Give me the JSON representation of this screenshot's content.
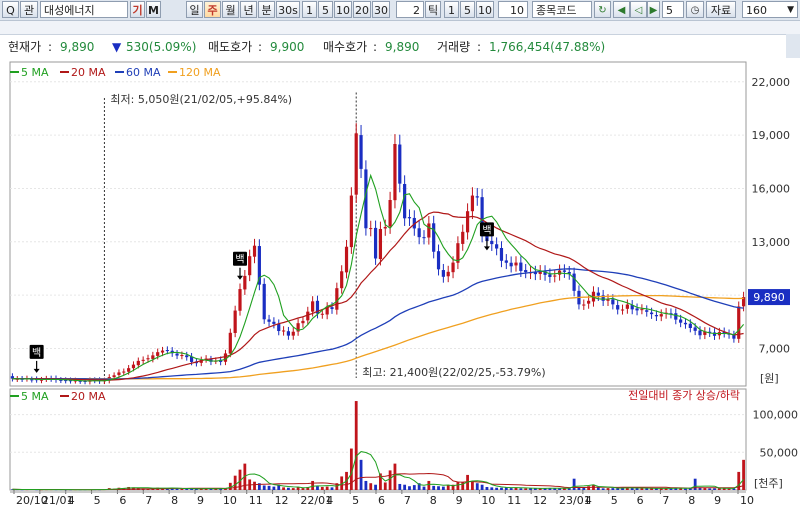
{
  "toolbar": {
    "search_label": "Q",
    "search_tag": "관",
    "stock_name": "대성에너지",
    "gi_button": "기",
    "m_button": "M",
    "periods": [
      "일",
      "주",
      "월",
      "년",
      "분",
      "30s",
      "1",
      "5",
      "10",
      "20",
      "30"
    ],
    "active_period": "주",
    "tick_value": "2",
    "tick_label": "틱",
    "tick_options": [
      "1",
      "5",
      "10"
    ],
    "interval_value": "10",
    "code_field": "종목코드",
    "step_value": "5",
    "data_label": "자료",
    "count_value": "160"
  },
  "info": {
    "price_label": "현재가",
    "price_value": "9,890",
    "change_value": "530(5.09%)",
    "ask_label": "매도호가",
    "ask_value": "9,900",
    "bid_label": "매수호가",
    "bid_value": "9,890",
    "volume_label": "거래량",
    "volume_value": "1,766,454(47.88%)"
  },
  "colors": {
    "up": "#c0141b",
    "down": "#1a2ec2",
    "ma5": "#20a020",
    "ma20": "#b01818",
    "ma60": "#1f3fb8",
    "ma120": "#f0a020"
  },
  "chart_data": [
    {
      "type": "candlestick",
      "legend": [
        "5 MA",
        "20 MA",
        "60 MA",
        "120 MA"
      ],
      "y_ticks": [
        7000,
        10000,
        13000,
        16000,
        19000,
        22000
      ],
      "ylim": [
        5000,
        23000
      ],
      "unit_label": "[원]",
      "x_ticks": [
        "20/10",
        "21/01",
        "4",
        "5",
        "6",
        "7",
        "8",
        "9",
        "10",
        "11",
        "12",
        "22/01",
        "4",
        "5",
        "6",
        "7",
        "8",
        "9",
        "10",
        "11",
        "12",
        "23/01",
        "4",
        "5",
        "6",
        "7",
        "8",
        "9",
        "10"
      ],
      "current_price_label": "9,890",
      "annotations": {
        "low": "최저: 5,050원(21/02/05,+95.84%)",
        "high": "최고: 21,400원(22/02/25,-53.79%)",
        "signal": "백"
      },
      "close": [
        5300,
        5290,
        5270,
        5310,
        5240,
        5230,
        5240,
        5300,
        5280,
        5230,
        5210,
        5190,
        5180,
        5200,
        5160,
        5140,
        5210,
        5200,
        5160,
        5200,
        5390,
        5490,
        5650,
        5700,
        5890,
        6090,
        6300,
        6360,
        6450,
        6610,
        6790,
        6880,
        6880,
        6730,
        6600,
        6630,
        6510,
        6240,
        6170,
        6350,
        6430,
        6250,
        6310,
        6240,
        6720,
        7880,
        9130,
        10340,
        11080,
        12190,
        12780,
        10590,
        8640,
        8500,
        8380,
        7980,
        8010,
        7720,
        7940,
        8420,
        8550,
        9070,
        9650,
        8960,
        8950,
        9320,
        9220,
        10390,
        11340,
        12720,
        15600,
        19100,
        17100,
        13760,
        13770,
        12060,
        13720,
        13830,
        15350,
        18500,
        16270,
        14320,
        14320,
        13750,
        13260,
        13250,
        14030,
        12440,
        11450,
        11030,
        11310,
        11830,
        12920,
        13560,
        14720,
        15600,
        15490,
        13370,
        13040,
        12870,
        12620,
        11930,
        11820,
        11620,
        11830,
        11360,
        11290,
        11280,
        11180,
        11350,
        11140,
        11020,
        11100,
        11380,
        11310,
        11200,
        10240,
        9480,
        9470,
        9680,
        10190,
        9970,
        9680,
        9760,
        9480,
        9190,
        9190,
        9470,
        9200,
        9140,
        9210,
        9060,
        8930,
        8810,
        8930,
        9010,
        8960,
        8620,
        8450,
        8360,
        8150,
        7990,
        7740,
        7960,
        7880,
        7710,
        7920,
        7850,
        7780,
        7550,
        9360,
        9890
      ],
      "open": [
        5440,
        5270,
        5290,
        5290,
        5260,
        5270,
        5200,
        5270,
        5310,
        5320,
        5230,
        5220,
        5210,
        5180,
        5180,
        5170,
        5130,
        5220,
        5220,
        5150,
        5190,
        5390,
        5510,
        5650,
        5690,
        5890,
        6060,
        6300,
        6390,
        6410,
        6580,
        6770,
        6910,
        6870,
        6710,
        6590,
        6610,
        6550,
        6270,
        6190,
        6390,
        6390,
        6310,
        6360,
        6250,
        6710,
        7870,
        9120,
        10320,
        11120,
        12160,
        12760,
        10630,
        8630,
        8500,
        8380,
        7960,
        7970,
        7720,
        7950,
        8420,
        8580,
        9070,
        9680,
        8940,
        8910,
        9320,
        9180,
        10390,
        11280,
        12700,
        15650,
        19000,
        17070,
        13720,
        13780,
        12030,
        13750,
        13860,
        15340,
        18470,
        16250,
        14390,
        14340,
        13760,
        13260,
        13240,
        14040,
        12470,
        11410,
        11060,
        11290,
        11820,
        12880,
        13530,
        14720,
        15560,
        15510,
        13400,
        13050,
        12860,
        12650,
        11950,
        11820,
        11670,
        11830,
        11410,
        11240,
        11310,
        11190,
        11340,
        11170,
        11050,
        11150,
        11390,
        11300,
        11210,
        10240,
        9450,
        9520,
        9640,
        10140,
        9990,
        9680,
        9760,
        9440,
        9180,
        9230,
        9440,
        9250,
        9200,
        9150,
        9020,
        8880,
        8800,
        8940,
        8980,
        8980,
        8630,
        8440,
        8390,
        8180,
        8010,
        7760,
        7940,
        7900,
        7740,
        7940,
        7830,
        7760,
        7540,
        9370
      ],
      "ma5": [
        5300,
        5290,
        5280,
        5290,
        5280,
        5260,
        5260,
        5260,
        5260,
        5260,
        5250,
        5240,
        5220,
        5200,
        5190,
        5170,
        5180,
        5180,
        5180,
        5180,
        5220,
        5290,
        5380,
        5490,
        5620,
        5770,
        5940,
        6100,
        6240,
        6360,
        6500,
        6620,
        6720,
        6780,
        6780,
        6740,
        6680,
        6540,
        6430,
        6380,
        6340,
        6300,
        6290,
        6320,
        6390,
        6620,
        7050,
        7650,
        8420,
        9280,
        10150,
        10990,
        11120,
        10960,
        10590,
        9910,
        8870,
        8540,
        8200,
        8020,
        8090,
        8340,
        8690,
        8920,
        9150,
        9370,
        9460,
        9650,
        9960,
        10550,
        11730,
        13320,
        14570,
        15720,
        16730,
        15970,
        14880,
        13960,
        13760,
        14100,
        14660,
        15640,
        15700,
        15230,
        14910,
        13990,
        13790,
        13700,
        13260,
        12700,
        12310,
        11990,
        11930,
        12100,
        12570,
        13200,
        13970,
        14250,
        14370,
        14440,
        14120,
        13640,
        13180,
        12850,
        12560,
        12230,
        11980,
        11640,
        11430,
        11380,
        11300,
        11200,
        11200,
        11240,
        11220,
        11200,
        10950,
        10640,
        10330,
        10010,
        9870,
        9790,
        9770,
        9780,
        9820,
        9720,
        9650,
        9560,
        9450,
        9310,
        9260,
        9230,
        9170,
        9100,
        9010,
        8960,
        8920,
        8860,
        8800,
        8680,
        8520,
        8310,
        8060,
        7950,
        7870,
        7840,
        7840,
        7840,
        7830,
        7760,
        8020,
        8350
      ],
      "ma20": [
        5300,
        5300,
        5290,
        5290,
        5290,
        5290,
        5290,
        5290,
        5290,
        5280,
        5270,
        5270,
        5260,
        5260,
        5250,
        5240,
        5240,
        5230,
        5230,
        5230,
        5220,
        5230,
        5250,
        5270,
        5310,
        5350,
        5400,
        5450,
        5510,
        5580,
        5650,
        5730,
        5810,
        5880,
        5950,
        6030,
        6100,
        6170,
        6240,
        6310,
        6370,
        6410,
        6450,
        6490,
        6540,
        6620,
        6760,
        6940,
        7180,
        7460,
        7770,
        7980,
        8090,
        8200,
        8300,
        8390,
        8460,
        8540,
        8620,
        8710,
        8780,
        8880,
        8970,
        9090,
        9190,
        9300,
        9400,
        9500,
        9560,
        9660,
        9900,
        10250,
        10680,
        10960,
        11270,
        11550,
        11860,
        12170,
        12510,
        12780,
        13110,
        13450,
        13760,
        14000,
        14200,
        14360,
        14580,
        14670,
        14650,
        14590,
        14560,
        14420,
        14390,
        14370,
        14380,
        14430,
        14370,
        14240,
        14070,
        13930,
        13770,
        13640,
        13530,
        13410,
        13290,
        13180,
        13060,
        12910,
        12740,
        12620,
        12530,
        12420,
        12320,
        12250,
        12170,
        12080,
        11940,
        11760,
        11570,
        11400,
        11250,
        11110,
        10990,
        10900,
        10780,
        10640,
        10510,
        10400,
        10270,
        10140,
        10030,
        9920,
        9810,
        9680,
        9560,
        9470,
        9410,
        9310,
        9200,
        9070,
        8920,
        8770,
        8610,
        8450,
        8300,
        8170,
        8040,
        7940,
        7840,
        7760,
        7790,
        7840
      ],
      "ma60": [
        5300,
        5300,
        5300,
        5300,
        5300,
        5300,
        5300,
        5300,
        5300,
        5300,
        5300,
        5290,
        5290,
        5290,
        5290,
        5290,
        5280,
        5280,
        5280,
        5280,
        5280,
        5280,
        5280,
        5290,
        5300,
        5310,
        5320,
        5340,
        5350,
        5370,
        5390,
        5410,
        5430,
        5450,
        5470,
        5490,
        5510,
        5530,
        5540,
        5560,
        5580,
        5600,
        5620,
        5640,
        5670,
        5700,
        5760,
        5830,
        5920,
        6020,
        6130,
        6220,
        6270,
        6320,
        6370,
        6420,
        6460,
        6510,
        6550,
        6600,
        6650,
        6700,
        6760,
        6810,
        6860,
        6910,
        6960,
        7030,
        7120,
        7220,
        7360,
        7560,
        7740,
        7880,
        8020,
        8140,
        8280,
        8420,
        8580,
        8780,
        8950,
        9080,
        9200,
        9300,
        9400,
        9500,
        9610,
        9690,
        9770,
        9850,
        9920,
        10000,
        10110,
        10240,
        10390,
        10550,
        10680,
        10770,
        10840,
        10900,
        10960,
        11020,
        11070,
        11120,
        11170,
        11210,
        11240,
        11270,
        11300,
        11330,
        11360,
        11390,
        11420,
        11450,
        11470,
        11480,
        11470,
        11440,
        11410,
        11390,
        11370,
        11350,
        11330,
        11300,
        11270,
        11230,
        11190,
        11140,
        11080,
        11010,
        10950,
        10880,
        10800,
        10730,
        10650,
        10570,
        10480,
        10390,
        10300,
        10210,
        10110,
        10010,
        9920,
        9830,
        9740,
        9660,
        9580,
        9500,
        9420,
        9340,
        9300,
        9270
      ],
      "ma120": [
        5300,
        5300,
        5300,
        5300,
        5300,
        5300,
        5300,
        5300,
        5300,
        5300,
        5300,
        5300,
        5300,
        5300,
        5300,
        5300,
        5300,
        5300,
        5290,
        5290,
        5290,
        5290,
        5290,
        5290,
        5290,
        5290,
        5290,
        5290,
        5290,
        5290,
        5300,
        5300,
        5300,
        5300,
        5300,
        5300,
        5300,
        5310,
        5310,
        5310,
        5320,
        5320,
        5330,
        5340,
        5350,
        5360,
        5380,
        5400,
        5430,
        5460,
        5500,
        5540,
        5570,
        5600,
        5630,
        5660,
        5690,
        5720,
        5750,
        5780,
        5820,
        5860,
        5900,
        5950,
        6000,
        6050,
        6100,
        6150,
        6210,
        6270,
        6350,
        6450,
        6550,
        6640,
        6730,
        6820,
        6910,
        7000,
        7090,
        7190,
        7290,
        7390,
        7490,
        7580,
        7670,
        7760,
        7850,
        7940,
        8020,
        8100,
        8180,
        8260,
        8340,
        8420,
        8510,
        8600,
        8690,
        8770,
        8850,
        8920,
        8990,
        9060,
        9130,
        9200,
        9260,
        9320,
        9380,
        9440,
        9500,
        9560,
        9610,
        9660,
        9710,
        9760,
        9800,
        9830,
        9850,
        9870,
        9880,
        9890,
        9900,
        9910,
        9920,
        9930,
        9940,
        9950,
        9960,
        9960,
        9970,
        9970,
        9970,
        9970,
        9970,
        9970,
        9970,
        9960,
        9950,
        9940,
        9920,
        9910,
        9900,
        9890,
        9880,
        9870,
        9860,
        9850,
        9840,
        9830,
        9820,
        9810,
        9810,
        9820
      ]
    },
    {
      "type": "bar",
      "legend": [
        "5 MA",
        "20 MA"
      ],
      "label": "전일대비 종가 상승/하락",
      "y_ticks": [
        50000,
        100000
      ],
      "ylim": [
        0,
        130000
      ],
      "unit_label": "[천주]",
      "values": [
        900,
        700,
        500,
        600,
        800,
        500,
        400,
        500,
        600,
        500,
        600,
        400,
        300,
        500,
        400,
        500,
        600,
        500,
        400,
        800,
        2500,
        1800,
        3000,
        2200,
        4000,
        3500,
        2600,
        2200,
        2000,
        2600,
        3200,
        2600,
        2500,
        2200,
        1800,
        1500,
        1800,
        2200,
        1500,
        1800,
        2000,
        1800,
        1500,
        1900,
        2500,
        9500,
        19000,
        27000,
        35000,
        14000,
        11000,
        9000,
        6000,
        5500,
        4500,
        7000,
        3500,
        3000,
        2500,
        3800,
        2500,
        4000,
        12000,
        5000,
        4000,
        4500,
        3500,
        9000,
        18000,
        24000,
        55000,
        118000,
        40000,
        12000,
        9000,
        7000,
        22000,
        10000,
        26000,
        35000,
        8000,
        7000,
        5000,
        6500,
        9000,
        4500,
        12000,
        5500,
        5000,
        4500,
        6000,
        7000,
        11000,
        10000,
        20000,
        12000,
        9000,
        7000,
        4000,
        3500,
        3000,
        3000,
        4000,
        2500,
        3500,
        2200,
        2000,
        2200,
        2000,
        2500,
        2000,
        2500,
        2200,
        2500,
        2000,
        2500,
        15000,
        4000,
        3500,
        5000,
        7000,
        3500,
        2200,
        2500,
        2500,
        2200,
        3000,
        3500,
        2500,
        2200,
        2000,
        2500,
        2200,
        2000,
        2000,
        2200,
        2500,
        2500,
        2000,
        1800,
        3000,
        15000,
        3500,
        2500,
        2000,
        2200,
        2500,
        2000,
        1800,
        2000,
        24000,
        40000
      ],
      "up": [
        0,
        0,
        0,
        1,
        0,
        0,
        1,
        1,
        1,
        0,
        0,
        0,
        0,
        1,
        0,
        0,
        1,
        0,
        0,
        1,
        1,
        1,
        1,
        1,
        1,
        1,
        1,
        1,
        1,
        1,
        1,
        1,
        0,
        0,
        0,
        1,
        0,
        0,
        0,
        1,
        1,
        0,
        1,
        0,
        1,
        1,
        1,
        1,
        1,
        1,
        1,
        0,
        0,
        0,
        0,
        0,
        1,
        0,
        1,
        1,
        1,
        1,
        1,
        0,
        1,
        1,
        0,
        1,
        1,
        1,
        1,
        1,
        0,
        0,
        1,
        0,
        1,
        1,
        1,
        1,
        0,
        0,
        0,
        0,
        0,
        0,
        1,
        0,
        0,
        0,
        1,
        1,
        1,
        1,
        1,
        1,
        0,
        0,
        0,
        0,
        0,
        0,
        0,
        0,
        1,
        0,
        1,
        0,
        0,
        1,
        0,
        0,
        0,
        0,
        1,
        0,
        0,
        0,
        0,
        1,
        1,
        0,
        0,
        1,
        0,
        0,
        0,
        1,
        0,
        0,
        1,
        0,
        1,
        0,
        1,
        1,
        0,
        0,
        1,
        0,
        0,
        0,
        0,
        1,
        0,
        0,
        1,
        1,
        1,
        0,
        1,
        1
      ]
    }
  ]
}
